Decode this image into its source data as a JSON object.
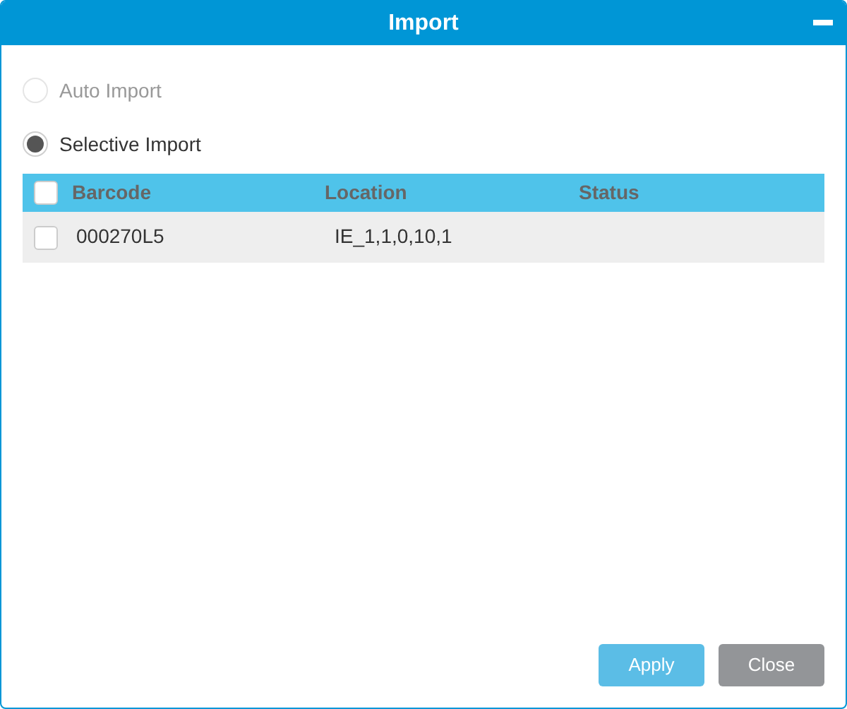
{
  "window": {
    "title": "Import"
  },
  "import_modes": [
    {
      "label": "Auto Import",
      "selected": false,
      "disabled": true
    },
    {
      "label": "Selective Import",
      "selected": true,
      "disabled": false
    }
  ],
  "table": {
    "select_all_checked": false,
    "columns": [
      "Barcode",
      "Location",
      "Status"
    ],
    "rows": [
      {
        "checked": false,
        "cells": [
          "000270L5",
          "IE_1,1,0,10,1",
          ""
        ]
      }
    ]
  },
  "buttons": [
    {
      "label": "Apply",
      "kind": "primary"
    },
    {
      "label": "Close",
      "kind": "secondary"
    }
  ]
}
